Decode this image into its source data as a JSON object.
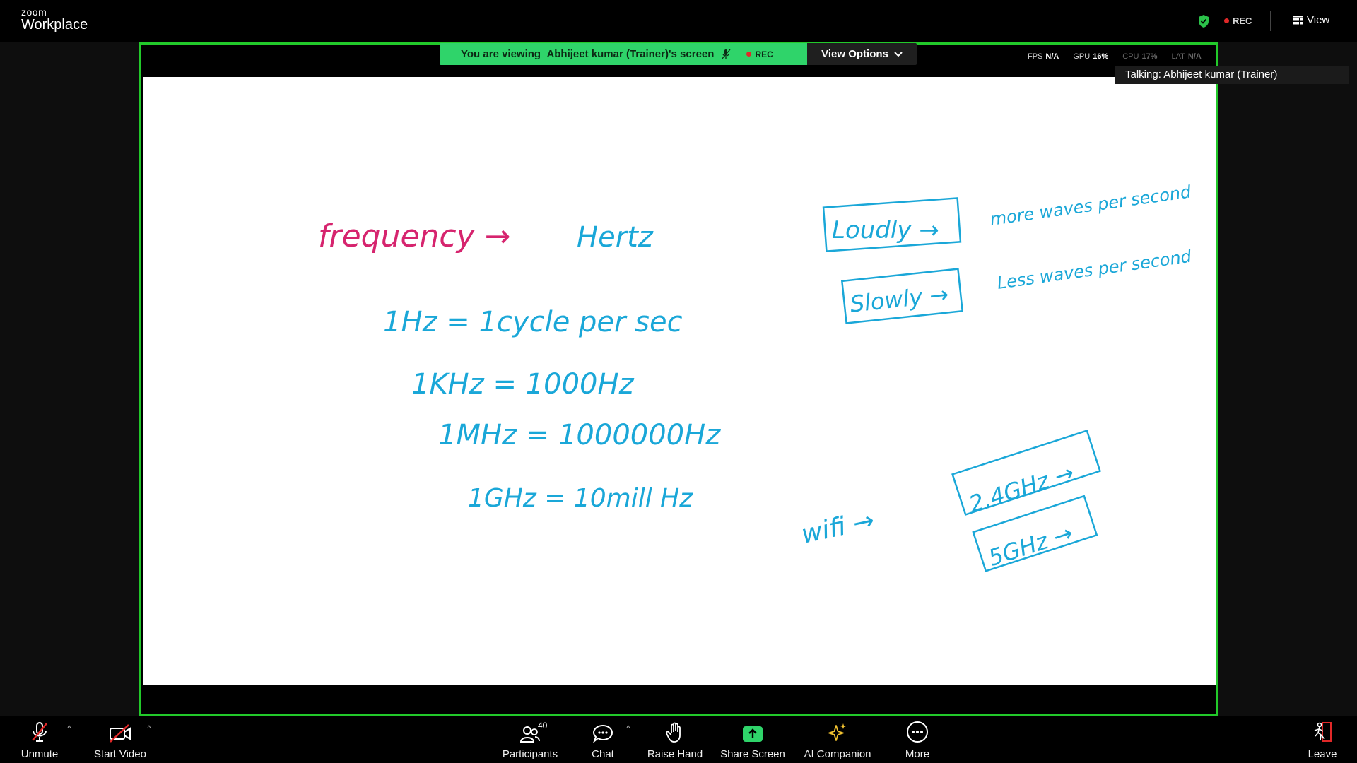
{
  "app": {
    "logo_small": "zoom",
    "logo_big": "Workplace",
    "rec_label": "REC",
    "view_label": "View"
  },
  "share": {
    "banner_prefix": "You are viewing",
    "banner_name": "Abhijeet kumar (Trainer)",
    "banner_suffix": "'s screen",
    "banner_rec": "REC",
    "view_options_label": "View Options"
  },
  "stats": {
    "fps_label": "FPS",
    "fps_value": "N/A",
    "gpu_label": "GPU",
    "gpu_value": "16%",
    "cpu_label": "CPU",
    "cpu_value": "17%",
    "lat_label": "LAT",
    "lat_value": "N/A"
  },
  "talking": "Talking: Abhijeet kumar (Trainer)",
  "toolbar": {
    "unmute": "Unmute",
    "start_video": "Start Video",
    "participants": "Participants",
    "participants_count": "40",
    "chat": "Chat",
    "raise_hand": "Raise Hand",
    "share_screen": "Share Screen",
    "ai_companion": "AI Companion",
    "more": "More",
    "leave": "Leave"
  },
  "whiteboard": {
    "frequency": "frequency →",
    "hertz": "Hertz",
    "line1": "1Hz = 1cycle per sec",
    "line2": "1KHz = 1000Hz",
    "line3": "1MHz = 1000000Hz",
    "line4": "1GHz = 10mill Hz",
    "loudly": "Loudly →",
    "more_waves": "more waves per second",
    "slowly": "Slowly →",
    "less_waves": "Less waves per second",
    "wifi": "wifi →",
    "band1": "2.4GHz →",
    "band2": "5GHz →"
  },
  "colors": {
    "accent_green": "#22c92a",
    "banner_green": "#2fd46a",
    "ink_pink": "#d6246e",
    "ink_blue": "#1aa7d8",
    "rec_red": "#e02828"
  }
}
